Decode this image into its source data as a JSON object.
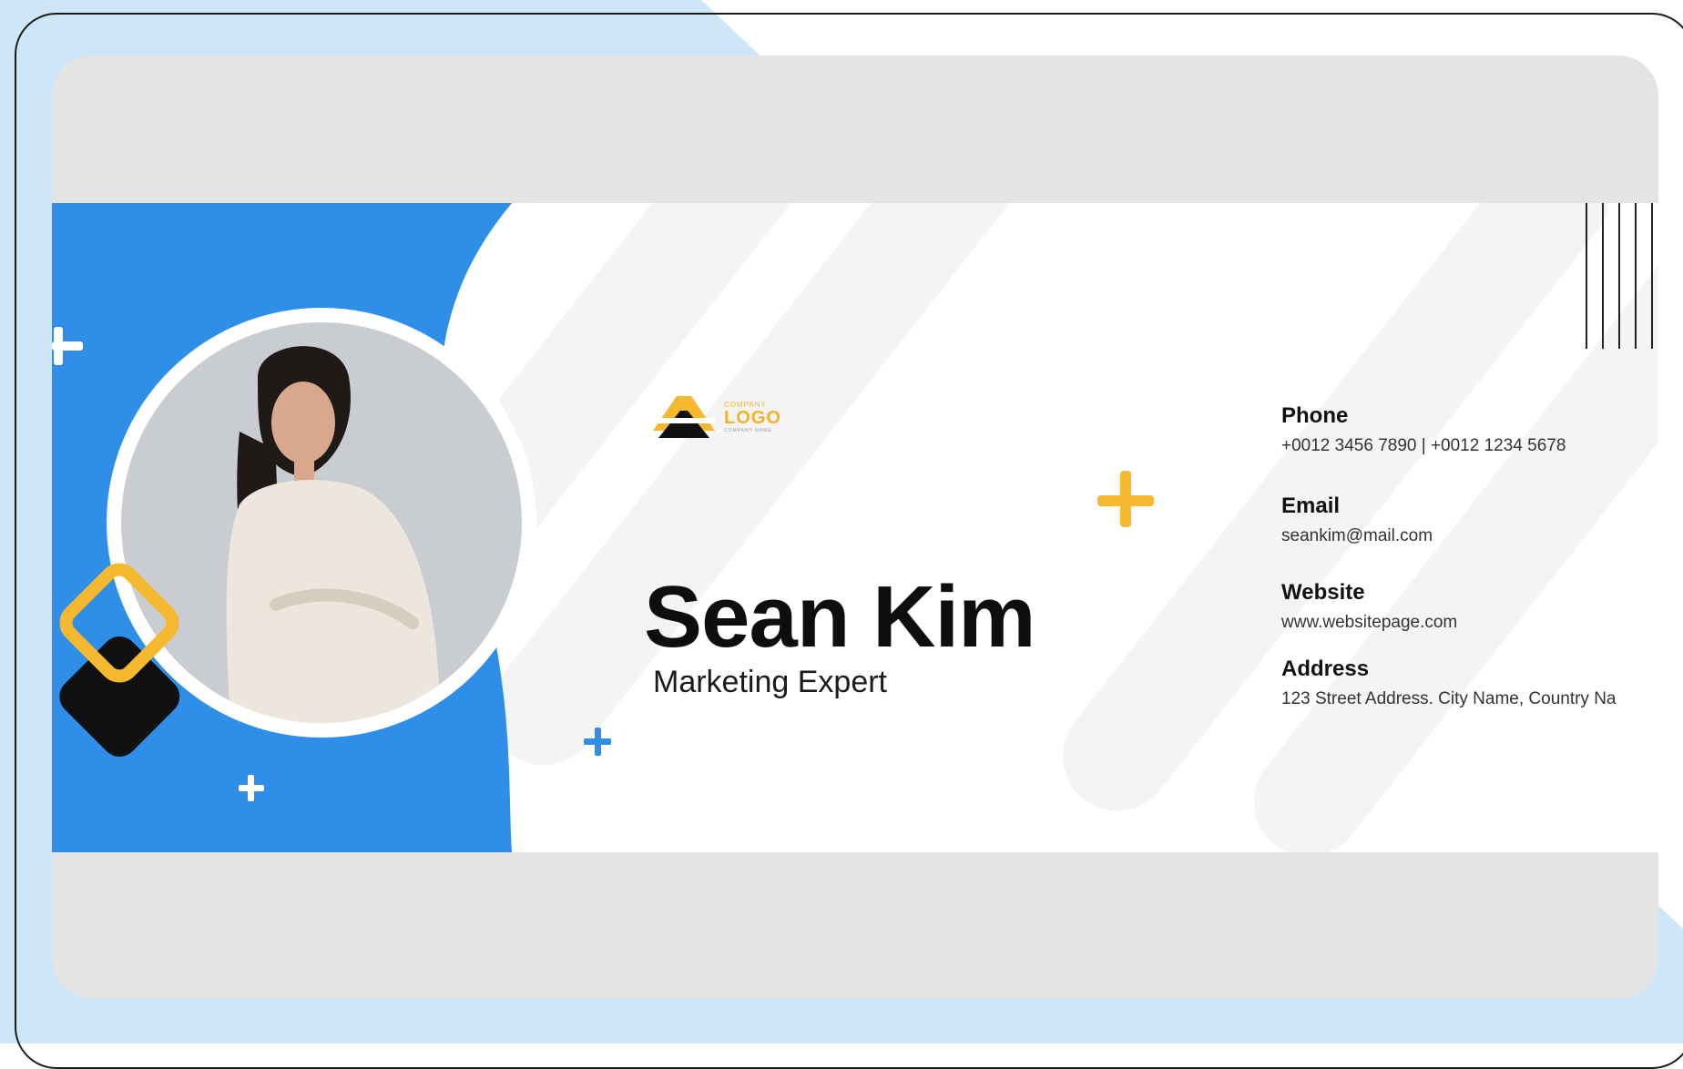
{
  "colors": {
    "accent_blue": "#2f8fe8",
    "accent_yellow": "#f5b82e",
    "dark": "#111111",
    "background_light_blue": "#cde6f8"
  },
  "logo": {
    "small_text": "COMPANY",
    "main_text": "LOGO",
    "tagline": "COMPANY NAME"
  },
  "profile": {
    "name": "Sean Kim",
    "title": "Marketing Expert"
  },
  "contact": {
    "phone": {
      "label": "Phone",
      "value": "+0012 3456 7890 | +0012 1234 5678"
    },
    "email": {
      "label": "Email",
      "value": "seankim@mail.com"
    },
    "website": {
      "label": "Website",
      "value": "www.websitepage.com"
    },
    "address": {
      "label": "Address",
      "value": "123 Street Address. City Name, Country Na"
    }
  },
  "icons": [
    "plus-icon",
    "diamond-outline-icon",
    "diamond-solid-icon",
    "vertical-lines-icon",
    "company-logo-icon"
  ]
}
